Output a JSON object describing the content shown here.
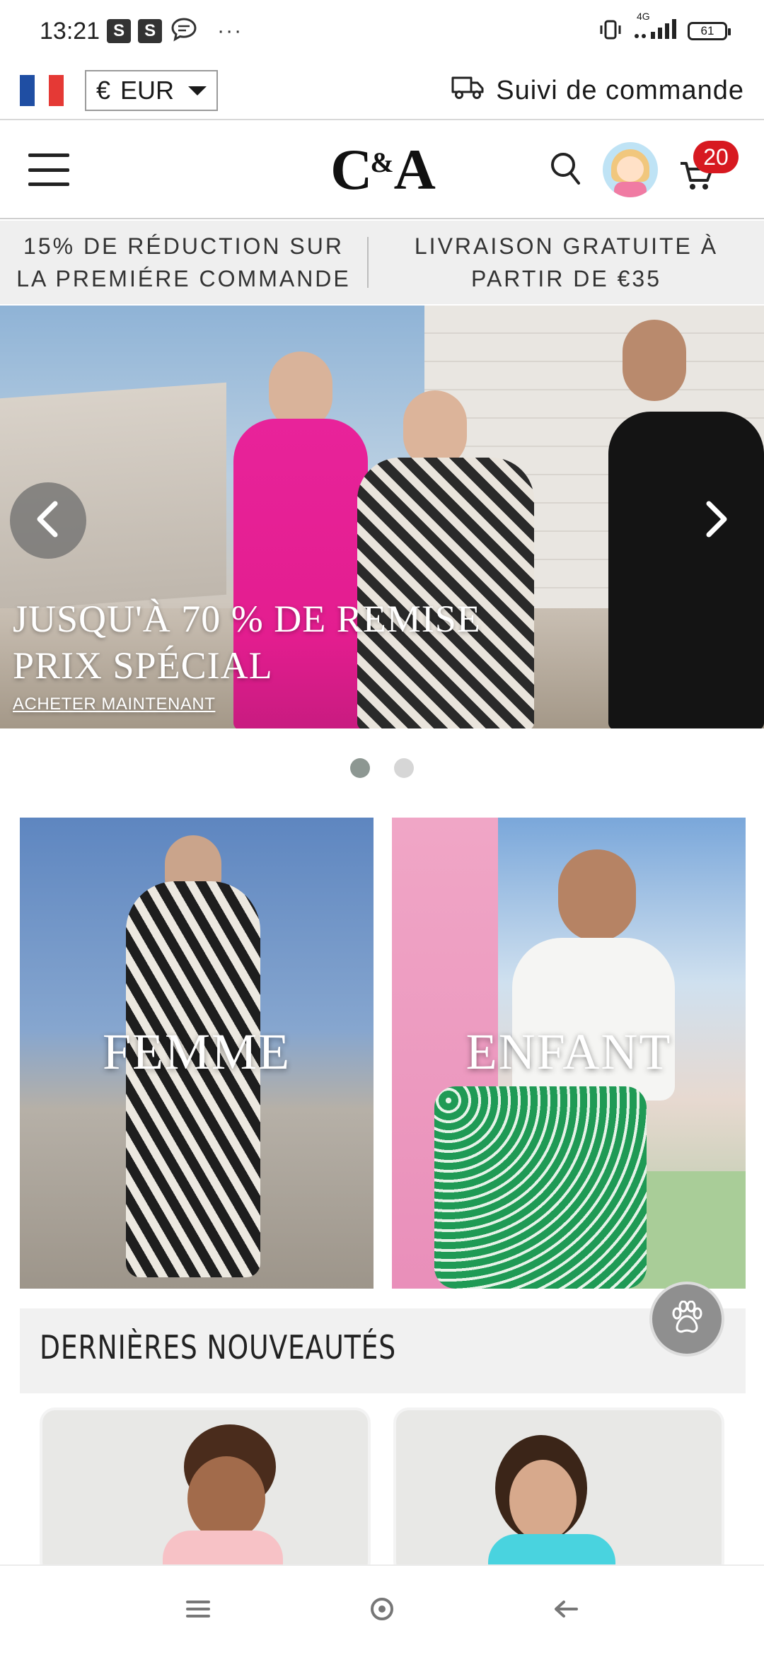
{
  "status_bar": {
    "time": "13:21",
    "badges": [
      "S",
      "S"
    ],
    "dots": "···",
    "network": "4G",
    "battery": "61"
  },
  "utility": {
    "currency_symbol": "€",
    "currency_code": "EUR",
    "tracking_label": "Suivi de commande",
    "flag_colors": [
      "#1f4ea3",
      "#ffffff",
      "#e53935"
    ]
  },
  "header": {
    "logo_main": "C",
    "logo_amp": "&",
    "logo_end": "A",
    "cart_count": "20"
  },
  "promo": {
    "left": "15% DE RÉDUCTION SUR LA PREMIÉRE COMMANDE",
    "right": "LIVRAISON GRATUITE À PARTIR DE €35"
  },
  "hero": {
    "title_line1": "JUSQU'À 70 % DE REMISE",
    "title_line2": "PRIX SPÉCIAL",
    "cta": "ACHETER MAINTENANT",
    "active_slide": 1,
    "slide_count": 2
  },
  "categories": [
    {
      "label": "FEMME"
    },
    {
      "label": "ENFANT"
    }
  ],
  "arrivals": {
    "title": "DERNIÈRES NOUVEAUTÉS"
  },
  "colors": {
    "accent_red": "#d71920",
    "promo_bg": "#efefef"
  },
  "icons": {
    "tracking": "truck-icon",
    "search": "search-icon",
    "cart": "cart-icon",
    "menu": "hamburger-menu-icon",
    "paw": "paw-icon"
  }
}
